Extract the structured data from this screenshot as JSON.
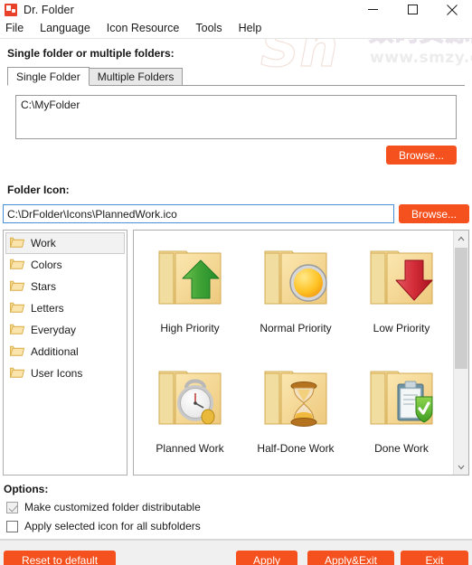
{
  "window": {
    "title": "Dr. Folder",
    "app_icon": "dr-folder-app-icon",
    "controls": {
      "minimize": "minimize-icon",
      "maximize": "maximize-icon",
      "close": "close-icon"
    }
  },
  "menubar": {
    "items": [
      {
        "label": "File"
      },
      {
        "label": "Language"
      },
      {
        "label": "Icon Resource"
      },
      {
        "label": "Tools"
      },
      {
        "label": "Help"
      }
    ]
  },
  "watermark": {
    "logo_text": "Sn",
    "cn_text": "数码资源网",
    "url_text": "www.smzy.com"
  },
  "folder_section": {
    "label": "Single folder or multiple folders:",
    "tabs": [
      {
        "label": "Single Folder",
        "active": true
      },
      {
        "label": "Multiple Folders",
        "active": false
      }
    ],
    "path_value": "C:\\MyFolder",
    "path_placeholder": "",
    "browse_label": "Browse..."
  },
  "icon_section": {
    "label": "Folder Icon:",
    "path_value": "C:\\DrFolder\\Icons\\PlannedWork.ico",
    "path_placeholder": "",
    "browse_label": "Browse...",
    "categories": [
      {
        "label": "Work",
        "selected": true
      },
      {
        "label": "Colors",
        "selected": false
      },
      {
        "label": "Stars",
        "selected": false
      },
      {
        "label": "Letters",
        "selected": false
      },
      {
        "label": "Everyday",
        "selected": false
      },
      {
        "label": "Additional",
        "selected": false
      },
      {
        "label": "User Icons",
        "selected": false
      }
    ],
    "icons": [
      {
        "label": "High Priority",
        "glyph": "green-up-arrow"
      },
      {
        "label": "Normal Priority",
        "glyph": "yellow-circle"
      },
      {
        "label": "Low Priority",
        "glyph": "red-down-arrow"
      },
      {
        "label": "Planned Work",
        "glyph": "alarm-clock"
      },
      {
        "label": "Half-Done Work",
        "glyph": "hourglass"
      },
      {
        "label": "Done Work",
        "glyph": "clipboard-check"
      }
    ],
    "scrollbar": {
      "up_arrow": "chevron-up-icon",
      "down_arrow": "chevron-down-icon"
    }
  },
  "options": {
    "label": "Options:",
    "items": [
      {
        "label": "Make customized folder distributable",
        "checked": true
      },
      {
        "label": "Apply selected icon for all subfolders",
        "checked": false
      }
    ]
  },
  "footer": {
    "reset_label": "Reset to default",
    "apply_label": "Apply",
    "apply_exit_label": "Apply&Exit",
    "exit_label": "Exit"
  },
  "colors": {
    "accent_orange": "#f4511e",
    "folder_yellow": "#f5d48a",
    "selection_gray": "#f2f2f2"
  }
}
